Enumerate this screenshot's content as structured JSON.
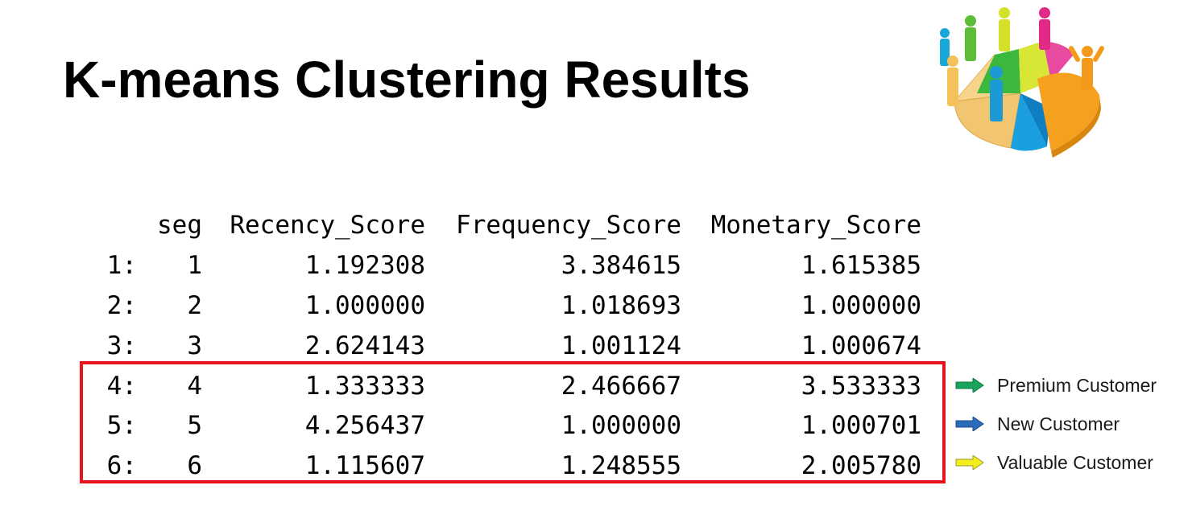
{
  "title": "K-means Clustering Results",
  "logo": {
    "icon": "people-pie-chart-icon"
  },
  "table": {
    "headers": [
      "seg",
      "Recency_Score",
      "Frequency_Score",
      "Monetary_Score"
    ],
    "rows": [
      {
        "index": "1:",
        "seg": "1",
        "recency": "1.192308",
        "frequency": "3.384615",
        "monetary": "1.615385"
      },
      {
        "index": "2:",
        "seg": "2",
        "recency": "1.000000",
        "frequency": "1.018693",
        "monetary": "1.000000"
      },
      {
        "index": "3:",
        "seg": "3",
        "recency": "2.624143",
        "frequency": "1.001124",
        "monetary": "1.000674"
      },
      {
        "index": "4:",
        "seg": "4",
        "recency": "1.333333",
        "frequency": "2.466667",
        "monetary": "3.533333"
      },
      {
        "index": "5:",
        "seg": "5",
        "recency": "4.256437",
        "frequency": "1.000000",
        "monetary": "1.000701"
      },
      {
        "index": "6:",
        "seg": "6",
        "recency": "1.115607",
        "frequency": "1.248555",
        "monetary": "2.005780"
      }
    ],
    "highlight_color": "#e8141b"
  },
  "legend": [
    {
      "label": "Premium Customer",
      "color": "#1aa35a",
      "icon": "arrow-right-icon"
    },
    {
      "label": "New Customer",
      "color": "#2b6cb8",
      "icon": "arrow-right-icon"
    },
    {
      "label": "Valuable Customer",
      "color": "#f3ef1f",
      "icon": "arrow-right-icon"
    }
  ]
}
